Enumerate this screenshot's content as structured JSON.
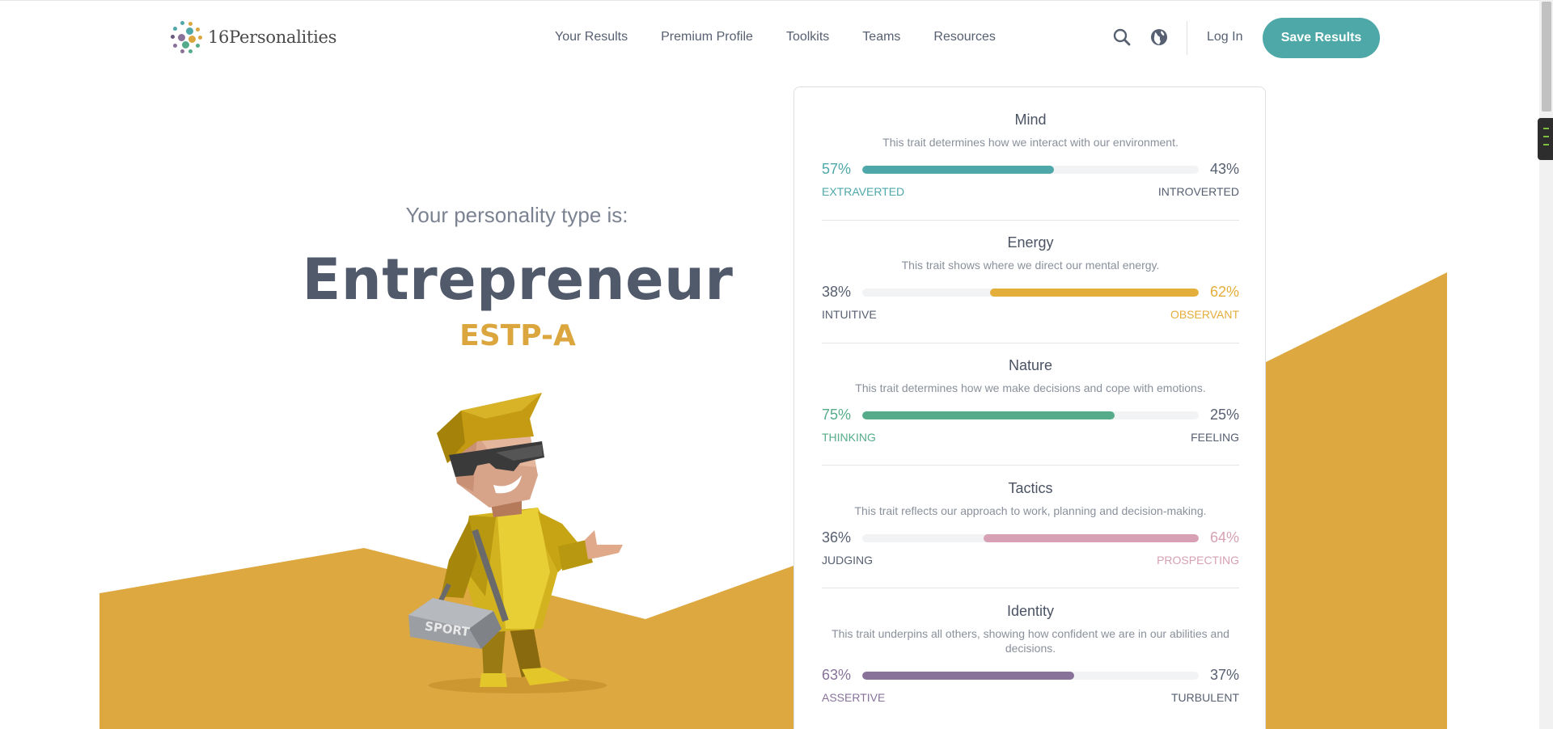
{
  "header": {
    "logo_text": "16Personalities",
    "nav": [
      "Your Results",
      "Premium Profile",
      "Toolkits",
      "Teams",
      "Resources"
    ],
    "login": "Log In",
    "save": "Save Results",
    "icons": [
      "search-icon",
      "globe-icon"
    ]
  },
  "hero": {
    "subtitle": "Your personality type is:",
    "type_name": "Entrepreneur",
    "type_code": "ESTP-A",
    "bag_label": "SPORT"
  },
  "traits": [
    {
      "name": "Mind",
      "description": "This trait determines how we interact with our environment.",
      "left_pct": "57%",
      "right_pct": "43%",
      "left_label": "EXTRAVERTED",
      "right_label": "INTROVERTED",
      "dominant": "left",
      "value": 57,
      "color": "#4ea8a9"
    },
    {
      "name": "Energy",
      "description": "This trait shows where we direct our mental energy.",
      "left_pct": "38%",
      "right_pct": "62%",
      "left_label": "INTUITIVE",
      "right_label": "OBSERVANT",
      "dominant": "right",
      "value": 62,
      "color": "#e4ae3a"
    },
    {
      "name": "Nature",
      "description": "This trait determines how we make decisions and cope with emotions.",
      "left_pct": "75%",
      "right_pct": "25%",
      "left_label": "THINKING",
      "right_label": "FEELING",
      "dominant": "left",
      "value": 75,
      "color": "#56ac8a"
    },
    {
      "name": "Tactics",
      "description": "This trait reflects our approach to work, planning and decision-making.",
      "left_pct": "36%",
      "right_pct": "64%",
      "left_label": "JUDGING",
      "right_label": "PROSPECTING",
      "dominant": "right",
      "value": 64,
      "color": "#d7a0b4"
    },
    {
      "name": "Identity",
      "description": "This trait underpins all others, showing how confident we are in our abilities and decisions.",
      "left_pct": "63%",
      "right_pct": "37%",
      "left_label": "ASSERTIVE",
      "right_label": "TURBULENT",
      "dominant": "left",
      "value": 63,
      "color": "#88729a"
    }
  ],
  "colors": {
    "accent": "#4fa8a8",
    "explorer_yellow": "#dca63e",
    "text": "#576071"
  }
}
